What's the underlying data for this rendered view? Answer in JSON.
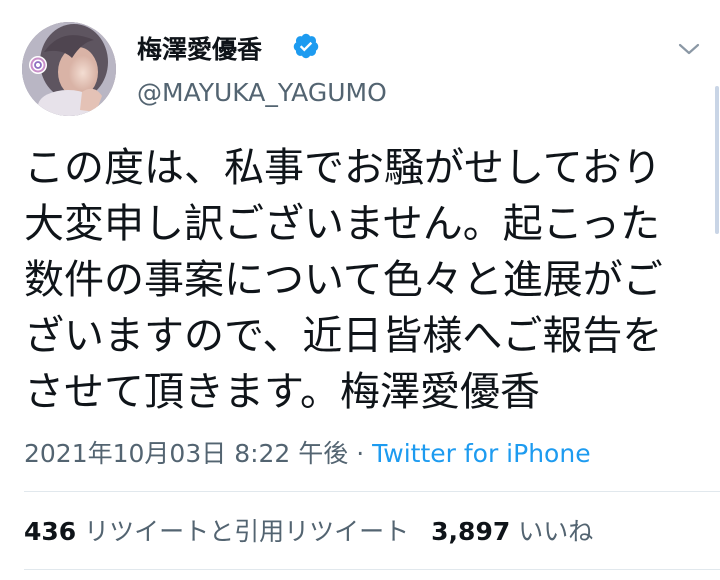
{
  "user": {
    "display_name": "梅澤愛優香",
    "handle": "@MAYUKA_YAGUMO",
    "avatar_icon": "profile-photo",
    "verified_icon": "verified-badge-icon"
  },
  "tweet": {
    "lines": [
      "この度は、私事でお騒がせしており",
      "大変申し訳ございません。起こった",
      "数件の事案について色々と進展がご",
      "ざいますので、近日皆様へご報告を",
      "させて頂きます。梅澤愛優香"
    ]
  },
  "meta": {
    "timestamp": "2021年10月03日 8:22 午後",
    "separator": " · ",
    "source": "Twitter for iPhone"
  },
  "stats": {
    "retweets_count": "436",
    "retweets_label": "リツイートと引用リツイート",
    "likes_count": "3,897",
    "likes_label": "いいね"
  },
  "colors": {
    "text": "#0f1419",
    "secondary": "#536471",
    "link": "#1d9bf0",
    "verified": "#1d9bf0",
    "divider": "#e1e8ed"
  }
}
